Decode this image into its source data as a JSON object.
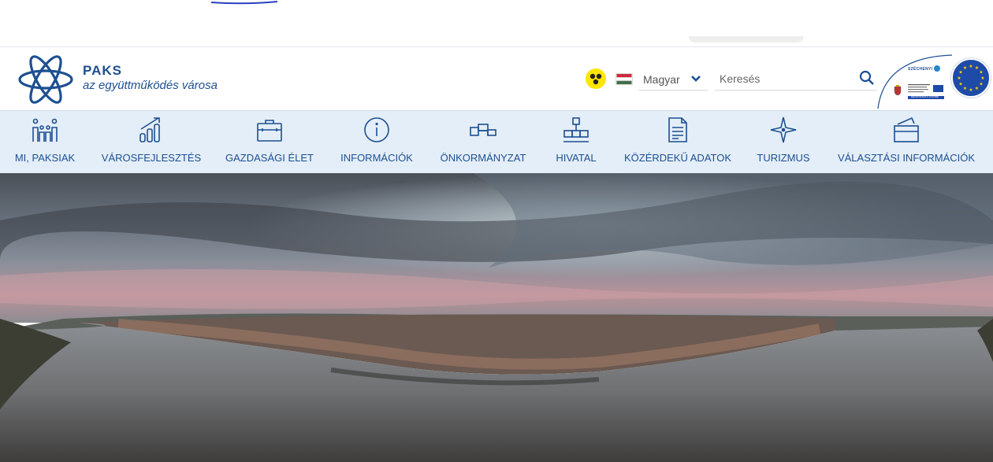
{
  "site": {
    "name": "PAKS",
    "tagline": "az együttműködés városa"
  },
  "header": {
    "language": "Magyar",
    "search_placeholder": "Keresés"
  },
  "szechenyi": {
    "label": "SZÉCHENYI",
    "bar_text": "BEFEKTETÉS A JÖVŐBE"
  },
  "nav": {
    "items": [
      {
        "label": "MI, PAKSIAK",
        "icon": "people-icon"
      },
      {
        "label": "VÁROSFEJLESZTÉS",
        "icon": "chart-growth-icon"
      },
      {
        "label": "GAZDASÁGI ÉLET",
        "icon": "briefcase-icon"
      },
      {
        "label": "INFORMÁCIÓK",
        "icon": "info-icon"
      },
      {
        "label": "ÖNKORMÁNYZAT",
        "icon": "podium-icon"
      },
      {
        "label": "HIVATAL",
        "icon": "org-chart-icon"
      },
      {
        "label": "KÖZÉRDEKŰ ADATOK",
        "icon": "document-icon"
      },
      {
        "label": "TURIZMUS",
        "icon": "compass-star-icon"
      },
      {
        "label": "VÁLASZTÁSI INFORMÁCIÓK",
        "icon": "ballot-box-icon"
      }
    ]
  },
  "colors": {
    "brand": "#1d4f91",
    "nav_bg": "#e4eef8",
    "accessibility": "#ffe600",
    "eu_blue": "#1e4aa8"
  }
}
